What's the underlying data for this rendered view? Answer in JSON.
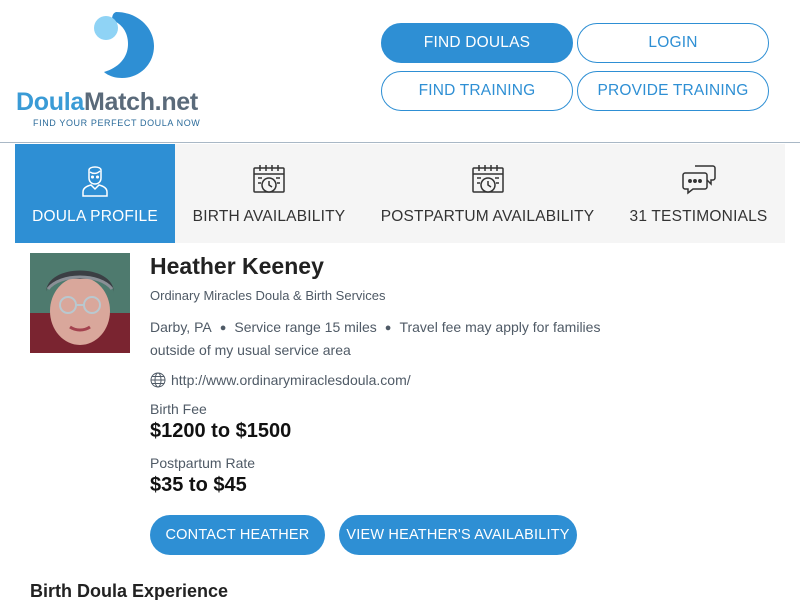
{
  "logo": {
    "name_part1": "Doula",
    "name_part2": "Match.net",
    "tagline": "FIND YOUR PERFECT DOULA NOW"
  },
  "nav": {
    "find_doulas": "FIND DOULAS",
    "login": "LOGIN",
    "find_training": "FIND TRAINING",
    "provide_training": "PROVIDE TRAINING"
  },
  "tabs": [
    {
      "label": "DOULA PROFILE",
      "icon": "doula-person-icon",
      "active": true
    },
    {
      "label": "BIRTH AVAILABILITY",
      "icon": "calendar-clock-icon",
      "active": false
    },
    {
      "label": "POSTPARTUM AVAILABILITY",
      "icon": "calendar-clock-icon",
      "active": false
    },
    {
      "label": "31 TESTIMONIALS",
      "icon": "chat-bubbles-icon",
      "active": false
    }
  ],
  "profile": {
    "name": "Heather Keeney",
    "business": "Ordinary Miracles Doula & Birth Services",
    "location": "Darby, PA",
    "service_range": "Service range 15 miles",
    "travel_fee_line1": "Travel fee may apply for families",
    "travel_fee_line2": "outside of my usual service area",
    "website": "http://www.ordinarymiraclesdoula.com/",
    "birth_fee_label": "Birth Fee",
    "birth_fee_value": "$1200 to $1500",
    "postpartum_label": "Postpartum Rate",
    "postpartum_value": "$35 to $45"
  },
  "actions": {
    "contact": "CONTACT HEATHER",
    "availability": "VIEW HEATHER'S AVAILABILITY"
  },
  "section": {
    "birth_experience_title": "Birth Doula Experience"
  },
  "colors": {
    "accent": "#2e8fd4",
    "tab_bg": "#f5f5f5",
    "muted_text": "#4f5a66"
  }
}
